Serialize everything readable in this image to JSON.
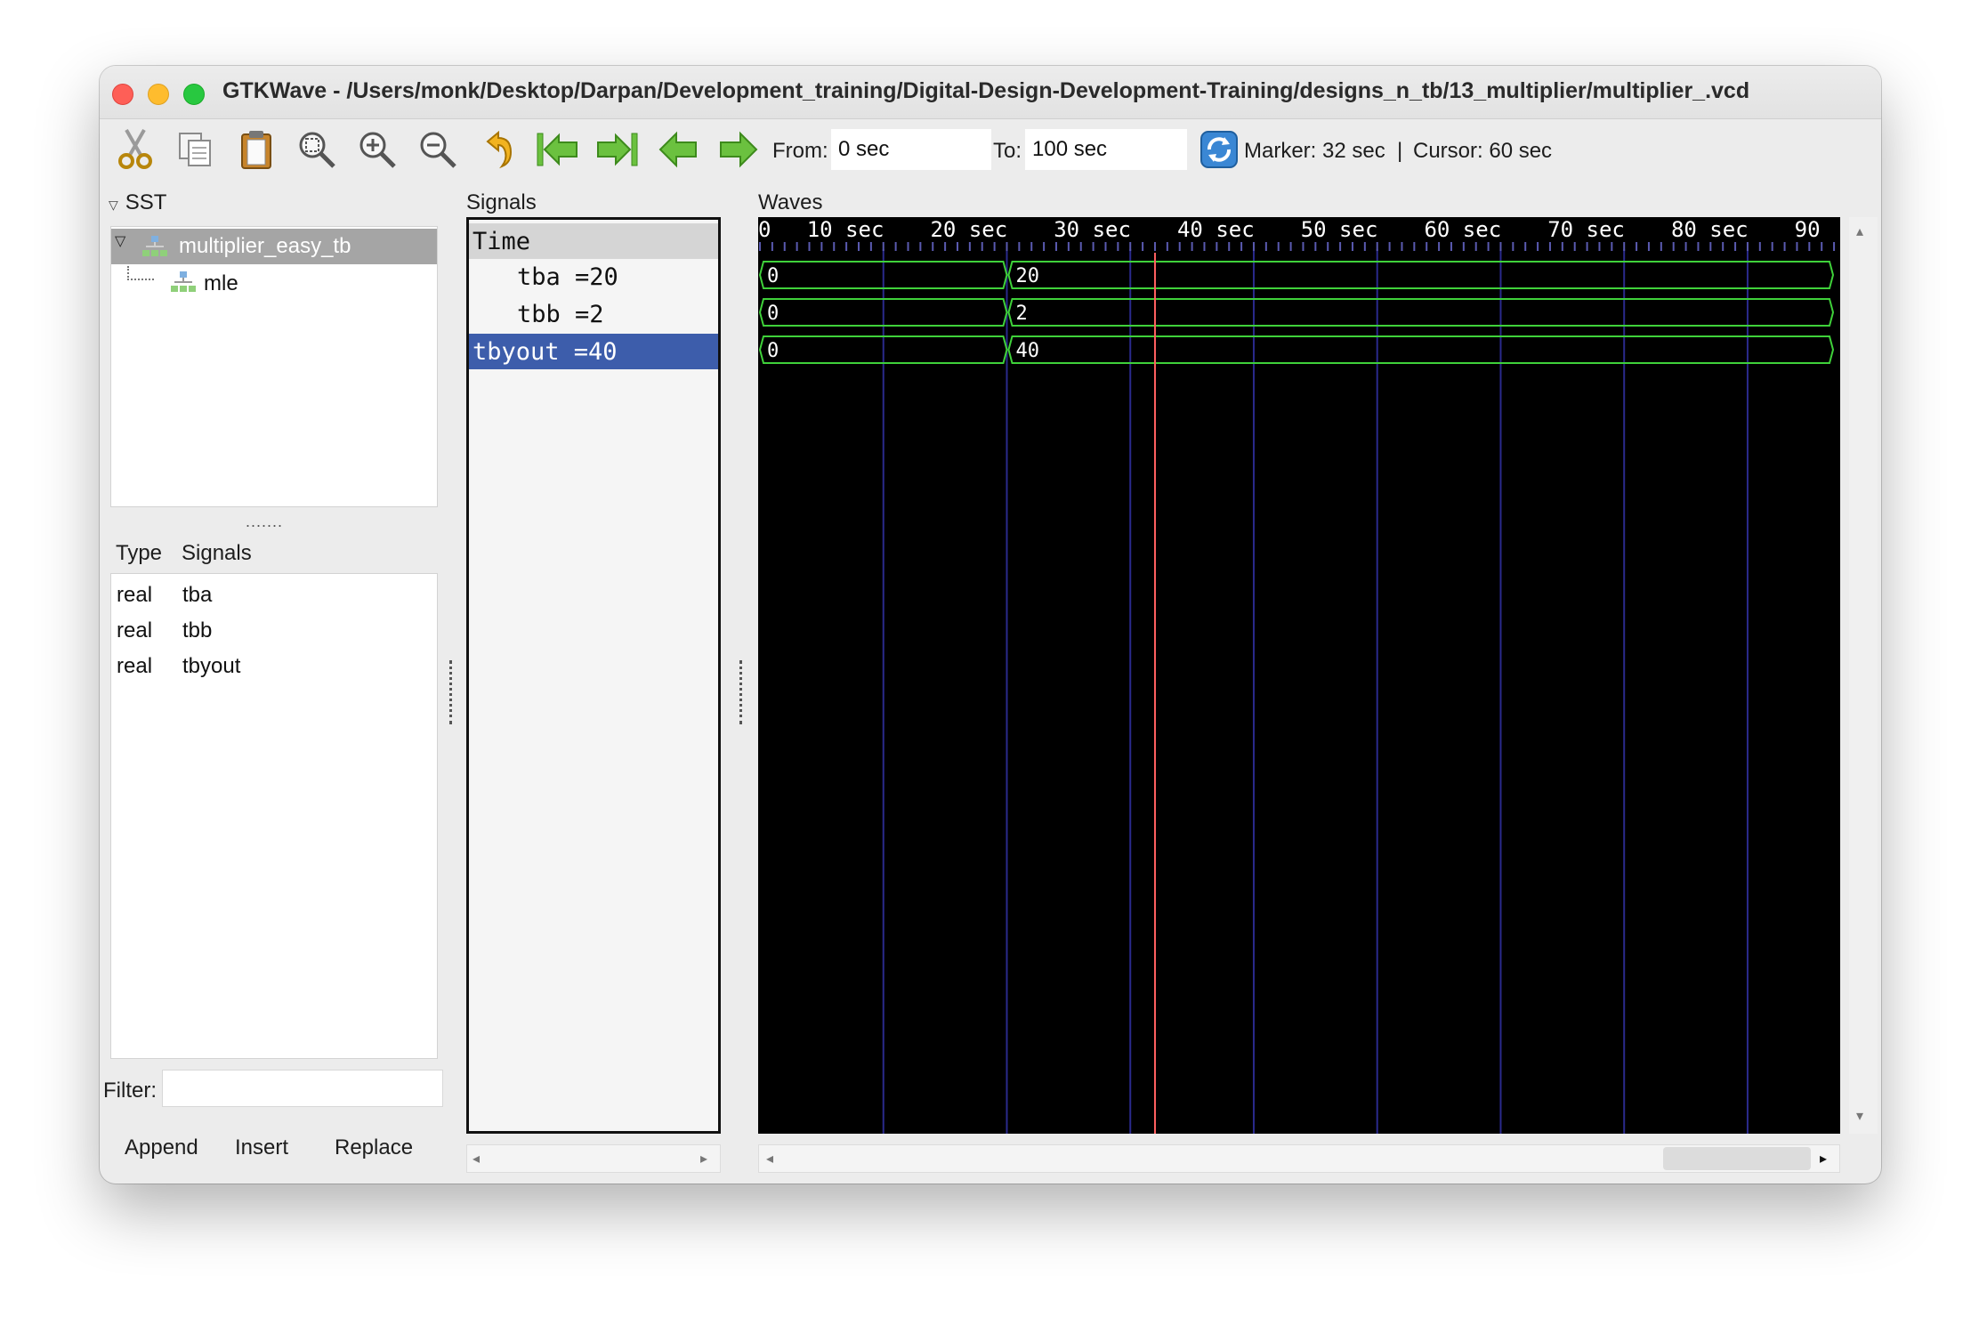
{
  "window": {
    "title": "GTKWave - /Users/monk/Desktop/Darpan/Development_training/Digital-Design-Development-Training/designs_n_tb/13_multiplier/multiplier_.vcd"
  },
  "toolbar": {
    "icons": [
      "cut-icon",
      "copy-icon",
      "paste-icon",
      "zoom-fit-icon",
      "zoom-in-icon",
      "zoom-out-icon",
      "undo-zoom-icon",
      "go-to-start-icon",
      "go-to-end-icon",
      "previous-edge-icon",
      "next-edge-icon",
      "reload-icon"
    ],
    "from_label": "From:",
    "from_value": "0 sec",
    "to_label": "To:",
    "to_value": "100 sec",
    "marker_label": "Marker: 32 sec",
    "separator": "|",
    "cursor_label": "Cursor: 60 sec"
  },
  "sst": {
    "header": "SST",
    "tree": [
      {
        "label": "multiplier_easy_tb",
        "selected": true
      },
      {
        "label": "mle",
        "selected": false
      }
    ],
    "grip": "......."
  },
  "signal_list": {
    "type_header": "Type",
    "signals_header": "Signals",
    "rows": [
      {
        "type": "real",
        "name": "tba"
      },
      {
        "type": "real",
        "name": "tbb"
      },
      {
        "type": "real",
        "name": "tbyout"
      }
    ]
  },
  "filter": {
    "label": "Filter:",
    "value": ""
  },
  "buttons": {
    "append": "Append",
    "insert": "Insert",
    "replace": "Replace"
  },
  "signals_panel": {
    "header": "Signals",
    "items": [
      {
        "label": "Time",
        "kind": "time",
        "selected": false
      },
      {
        "label": "tba =20",
        "kind": "signal",
        "selected": false
      },
      {
        "label": "tbb =2",
        "kind": "signal",
        "selected": false
      },
      {
        "label": "tbyout =40",
        "kind": "signal",
        "selected": true
      }
    ]
  },
  "waves": {
    "header": "Waves",
    "time_unit": "sec",
    "tick_labels": [
      "0",
      "10 sec",
      "20 sec",
      "30 sec",
      "40 sec",
      "50 sec",
      "60 sec",
      "70 sec",
      "80 sec",
      "90"
    ],
    "visible_range": [
      0,
      87.5
    ],
    "marker_time": 32,
    "traces": [
      {
        "name": "tba",
        "segments": [
          {
            "start": 0,
            "end": 20,
            "value": "0"
          },
          {
            "start": 20,
            "end": 100,
            "value": "20"
          }
        ]
      },
      {
        "name": "tbb",
        "segments": [
          {
            "start": 0,
            "end": 20,
            "value": "0"
          },
          {
            "start": 20,
            "end": 100,
            "value": "2"
          }
        ]
      },
      {
        "name": "tbyout",
        "segments": [
          {
            "start": 0,
            "end": 20,
            "value": "0"
          },
          {
            "start": 20,
            "end": 100,
            "value": "40"
          }
        ]
      }
    ],
    "colors": {
      "background": "#000000",
      "trace": "#3fd13a",
      "grid": "#2a2a8c",
      "marker": "#ff6060"
    }
  }
}
